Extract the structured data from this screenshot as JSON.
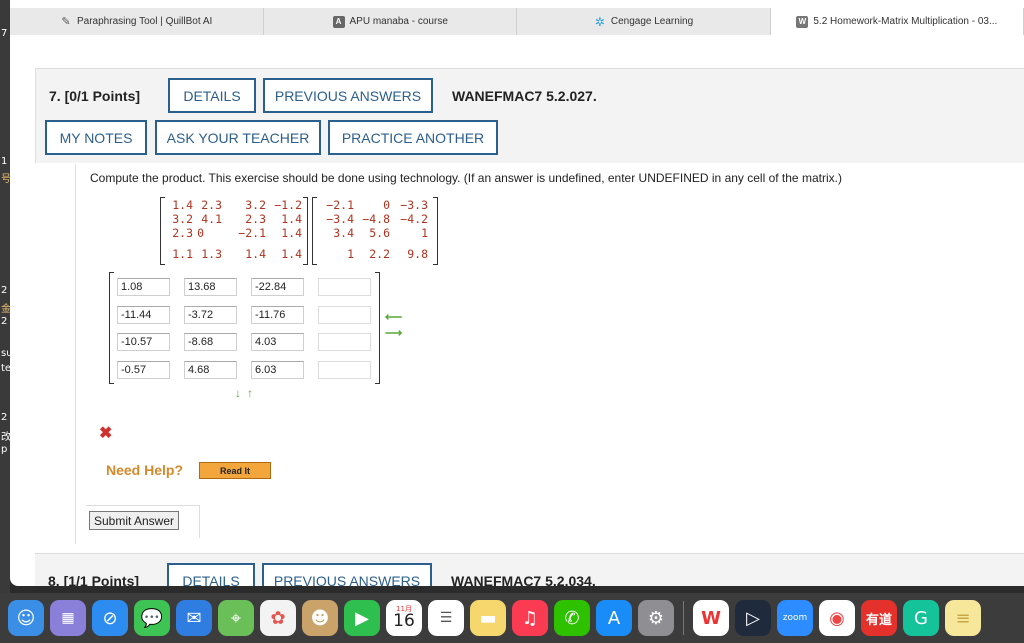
{
  "desktop_strip": [
    "7",
    "1",
    "号",
    "2",
    "金",
    "2",
    "su",
    "te",
    "2",
    "改",
    "p"
  ],
  "tabs": [
    {
      "icon": "quillbot-icon",
      "title": "Paraphrasing Tool | QuillBot AI",
      "active": false
    },
    {
      "icon": "apu-icon",
      "title": "APU manaba - course",
      "active": false
    },
    {
      "icon": "cengage-icon",
      "title": "Cengage Learning",
      "active": false
    },
    {
      "icon": "webassign-icon",
      "title": "5.2 Homework-Matrix Multiplication - 03...",
      "active": true
    }
  ],
  "question": {
    "number": "7.",
    "points": "[0/1 Points]",
    "details_label": "DETAILS",
    "previous_answers_label": "PREVIOUS ANSWERS",
    "code": "WANEFMAC7 5.2.027.",
    "my_notes_label": "MY NOTES",
    "ask_teacher_label": "ASK YOUR TEACHER",
    "practice_another_label": "PRACTICE ANOTHER",
    "prompt": "Compute the product. This exercise should be done using technology. (If an answer is undefined, enter UNDEFINED in any cell of the matrix.)",
    "matrix_a": [
      [
        "1.4",
        "2.3",
        "3.2",
        "−1.2"
      ],
      [
        "3.2",
        "4.1",
        "2.3",
        "1.4"
      ],
      [
        "2.3",
        "0",
        "−2.1",
        "1.4"
      ],
      [
        "1.1",
        "1.3",
        "1.4",
        "1.4"
      ]
    ],
    "matrix_b": [
      [
        "−2.1",
        "0",
        "−3.3"
      ],
      [
        "−3.4",
        "−4.8",
        "−4.2"
      ],
      [
        "3.4",
        "5.6",
        "1"
      ],
      [
        "1",
        "2.2",
        "9.8"
      ]
    ],
    "answer_matrix": [
      [
        "1.08",
        "13.68",
        "-22.84",
        ""
      ],
      [
        "-11.44",
        "-3.72",
        "-11.76",
        ""
      ],
      [
        "-10.57",
        "-8.68",
        "4.03",
        ""
      ],
      [
        "-0.57",
        "4.68",
        "6.03",
        ""
      ]
    ],
    "need_help_label": "Need Help?",
    "read_it_label": "Read It",
    "submit_label": "Submit Answer"
  },
  "next_question": {
    "number": "8.",
    "points": "[1/1 Points]",
    "details_label": "DETAILS",
    "previous_answers_label": "PREVIOUS ANSWERS",
    "code": "WANEFMAC7 5.2.034."
  },
  "dock": {
    "calendar_month": "11月",
    "calendar_day": "16",
    "zoom_label": "zoom",
    "youdao_label": "有道"
  }
}
